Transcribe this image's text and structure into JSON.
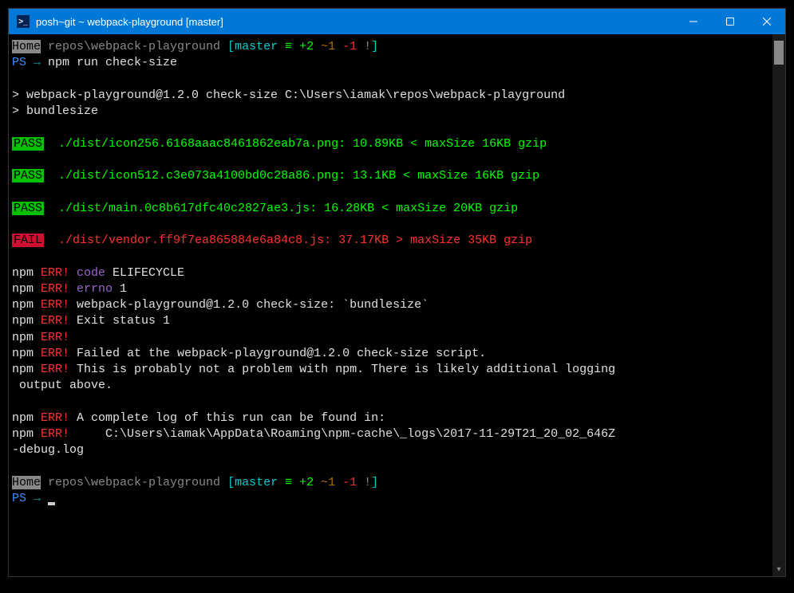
{
  "window": {
    "title": "posh~git ~ webpack-playground [master]"
  },
  "prompt1": {
    "home": "Home",
    "path": " repos\\webpack-playground ",
    "bracket_open": "[",
    "branch": "master",
    "equiv": " ≡ ",
    "plus": "+2",
    "tilde": " ~1",
    "minus": " -1",
    "bang": " !",
    "bracket_close": "]"
  },
  "ps_line": {
    "ps": "PS",
    "arrow": " → ",
    "cmd": "npm run check-size"
  },
  "npm_run": {
    "line1": "> webpack-playground@1.2.0 check-size C:\\Users\\iamak\\repos\\webpack-playground",
    "line2": "> bundlesize"
  },
  "results": [
    {
      "status": "PASS",
      "text": "  ./dist/icon256.6168aaac8461862eab7a.png: 10.89KB < maxSize 16KB gzip"
    },
    {
      "status": "PASS",
      "text": "  ./dist/icon512.c3e073a4100bd0c28a86.png: 13.1KB < maxSize 16KB gzip"
    },
    {
      "status": "PASS",
      "text": "  ./dist/main.0c8b617dfc40c2827ae3.js: 16.28KB < maxSize 20KB gzip"
    },
    {
      "status": "FAIL",
      "text": "  ./dist/vendor.ff9f7ea865884e6a84c8.js: 37.17KB > maxSize 35KB gzip"
    }
  ],
  "errors": {
    "npm": "npm",
    "err": " ERR!",
    "code_label": " code",
    "code_val": " ELIFECYCLE",
    "errno_label": " errno",
    "errno_val": " 1",
    "line3": " webpack-playground@1.2.0 check-size: `bundlesize`",
    "line4": " Exit status 1",
    "line6": " Failed at the webpack-playground@1.2.0 check-size script.",
    "line7a": " This is probably not a problem with npm. There is likely additional logging",
    "line7b": " output above.",
    "line9": " A complete log of this run can be found in:",
    "line10a": "     C:\\Users\\iamak\\AppData\\Roaming\\npm-cache\\_logs\\2017-11-29T21_20_02_646Z",
    "line10b": "-debug.log"
  },
  "prompt2": {
    "ps": "PS",
    "arrow": " → "
  }
}
